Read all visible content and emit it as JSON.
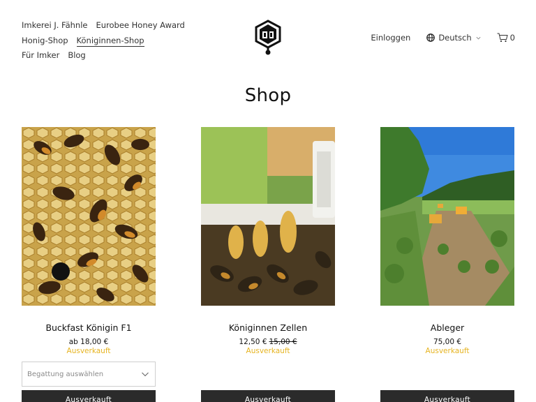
{
  "nav": {
    "row1": [
      "Imkerei J. Fähnle",
      "Eurobee Honey Award"
    ],
    "row2": [
      "Honig-Shop",
      "Königinnen-Shop"
    ],
    "row3": [
      "Für Imker",
      "Blog"
    ],
    "active": "Königinnen-Shop"
  },
  "header_right": {
    "login": "Einloggen",
    "language": "Deutsch",
    "cart_count": "0"
  },
  "page": {
    "title": "Shop"
  },
  "products": [
    {
      "name": "Buckfast Königin F1",
      "price": "ab 18,00 €",
      "old_price": "",
      "status": "Ausverkauft",
      "button": "Ausverkauft"
    },
    {
      "name": "Königinnen Zellen",
      "price": "12,50 €",
      "old_price": "15,00 €",
      "status": "Ausverkauft",
      "button": "Ausverkauft"
    },
    {
      "name": "Ableger",
      "price": "75,00 €",
      "old_price": "",
      "status": "Ausverkauft",
      "button": "Ausverkauft"
    }
  ],
  "variant_select": {
    "placeholder": "Begattung auswählen"
  },
  "colors": {
    "status": "#e6b422",
    "button_bg": "#2b2b2b"
  },
  "icons": [
    "logo-icon",
    "globe-icon",
    "chevron-down-icon",
    "cart-icon"
  ]
}
